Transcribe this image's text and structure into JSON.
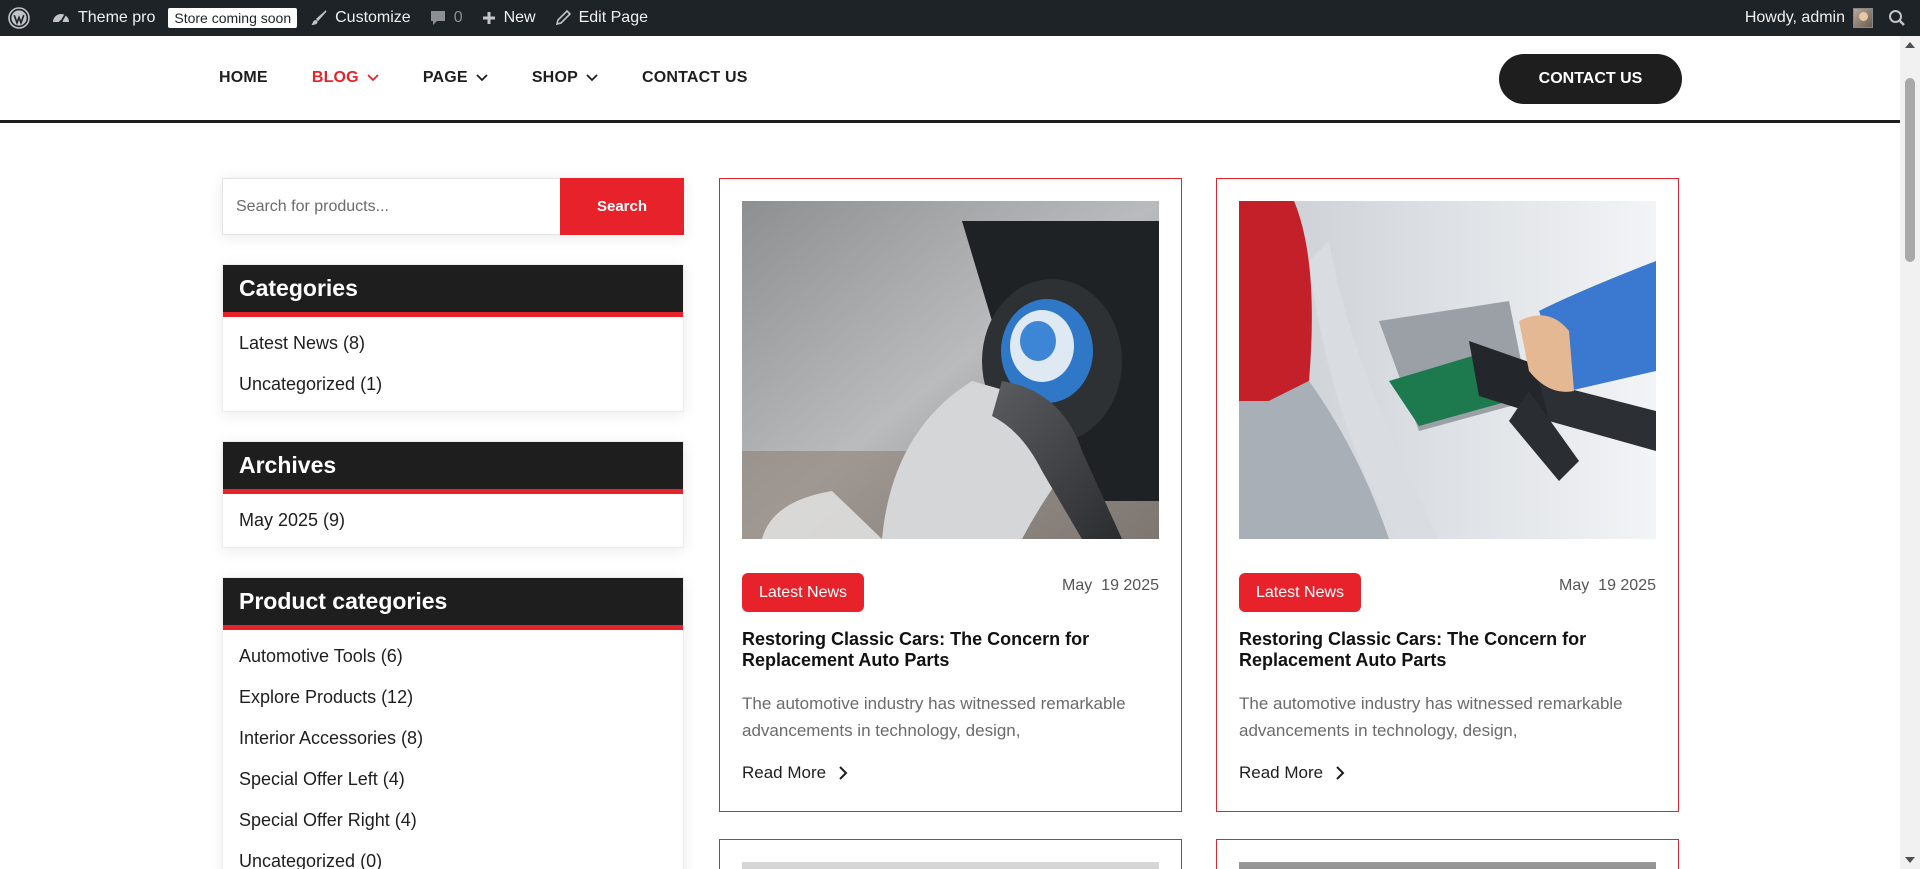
{
  "adminbar": {
    "site_name": "Theme pro",
    "badge": "Store coming soon",
    "customize": "Customize",
    "comments_count": "0",
    "new": "New",
    "edit_page": "Edit Page",
    "howdy": "Howdy, admin"
  },
  "nav": {
    "items": [
      {
        "label": "HOME"
      },
      {
        "label": "BLOG"
      },
      {
        "label": "PAGE"
      },
      {
        "label": "SHOP"
      },
      {
        "label": "CONTACT US"
      }
    ],
    "cta": "CONTACT US"
  },
  "sidebar": {
    "search_placeholder": "Search for products...",
    "search_button": "Search",
    "categories": {
      "title": "Categories",
      "items": [
        "Latest News (8)",
        "Uncategorized (1)"
      ]
    },
    "archives": {
      "title": "Archives",
      "items": [
        "May 2025 (9)"
      ]
    },
    "product_categories": {
      "title": "Product categories",
      "items": [
        "Automotive Tools (6)",
        "Explore Products (12)",
        "Interior Accessories (8)",
        "Special Offer Left (4)",
        "Special Offer Right (4)",
        "Uncategorized (0)"
      ]
    }
  },
  "posts": [
    {
      "category": "Latest News",
      "date": "May  19 2025",
      "title": "Restoring Classic Cars: The Concern for Replacement Auto Parts",
      "excerpt": "The automotive industry has witnessed remarkable advancements in technology, design,",
      "read_more": "Read More"
    },
    {
      "category": "Latest News",
      "date": "May  19 2025",
      "title": "Restoring Classic Cars: The Concern for Replacement Auto Parts",
      "excerpt": "The automotive industry has witnessed remarkable advancements in technology, design,",
      "read_more": "Read More"
    }
  ],
  "colors": {
    "accent": "#e8222b",
    "dark": "#1e1e1e",
    "adminbar": "#1d2327"
  },
  "icons": {
    "wordpress": "wordpress-logo-icon",
    "dashboard": "dashboard-gauge-icon",
    "customize": "paintbrush-icon",
    "comments": "comment-bubble-icon",
    "new": "plus-icon",
    "edit": "pencil-icon",
    "search": "search-icon",
    "chevron": "chevron-down-icon",
    "read_more": "chevron-right-icon"
  }
}
